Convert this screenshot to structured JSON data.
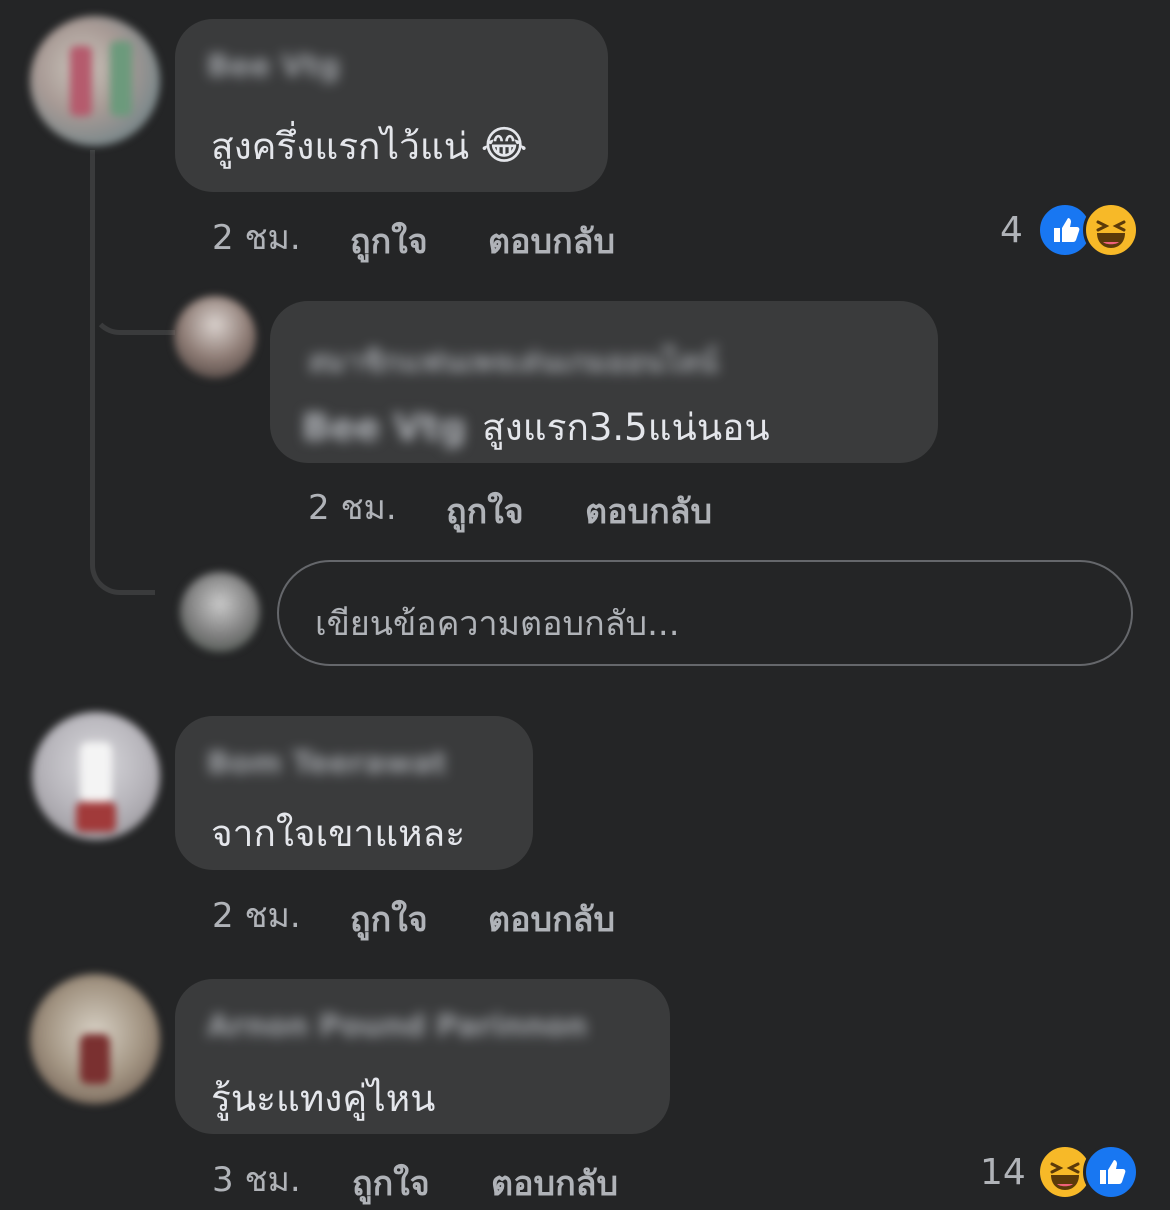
{
  "comments": [
    {
      "author": "Bee Vtg",
      "text": "สูงครึ่งแรกไว้แน่",
      "emoji": "😂",
      "time": "2 ชม.",
      "like_label": "ถูกใจ",
      "reply_label": "ตอบกลับ",
      "reaction_count": "4",
      "reactions": [
        "like-icon",
        "haha-icon"
      ]
    },
    {
      "author": "Bom Teerawat",
      "text": "จากใจเขาแหละ",
      "time": "2 ชม.",
      "like_label": "ถูกใจ",
      "reply_label": "ตอบกลับ"
    },
    {
      "author": "Arnon Pound Parinnon",
      "text": "รู้นะแทงคู่ไหน",
      "time": "3 ชม.",
      "like_label": "ถูกใจ",
      "reply_label": "ตอบกลับ",
      "reaction_count": "14",
      "reactions": [
        "haha-icon",
        "like-icon"
      ]
    }
  ],
  "reply": {
    "author": "สมาชิกแฟนเพจเล่นเกมออนไลน์",
    "mention": "Bee Vtg",
    "text": "สูงแรก3.5แน่นอน",
    "time": "2 ชม.",
    "like_label": "ถูกใจ",
    "reply_label": "ตอบกลับ"
  },
  "reply_input": {
    "placeholder": "เขียนข้อความตอบกลับ..."
  },
  "colors": {
    "background": "#242526",
    "bubble": "#3a3b3c",
    "like": "#1877f2",
    "haha": "#f7b928"
  }
}
